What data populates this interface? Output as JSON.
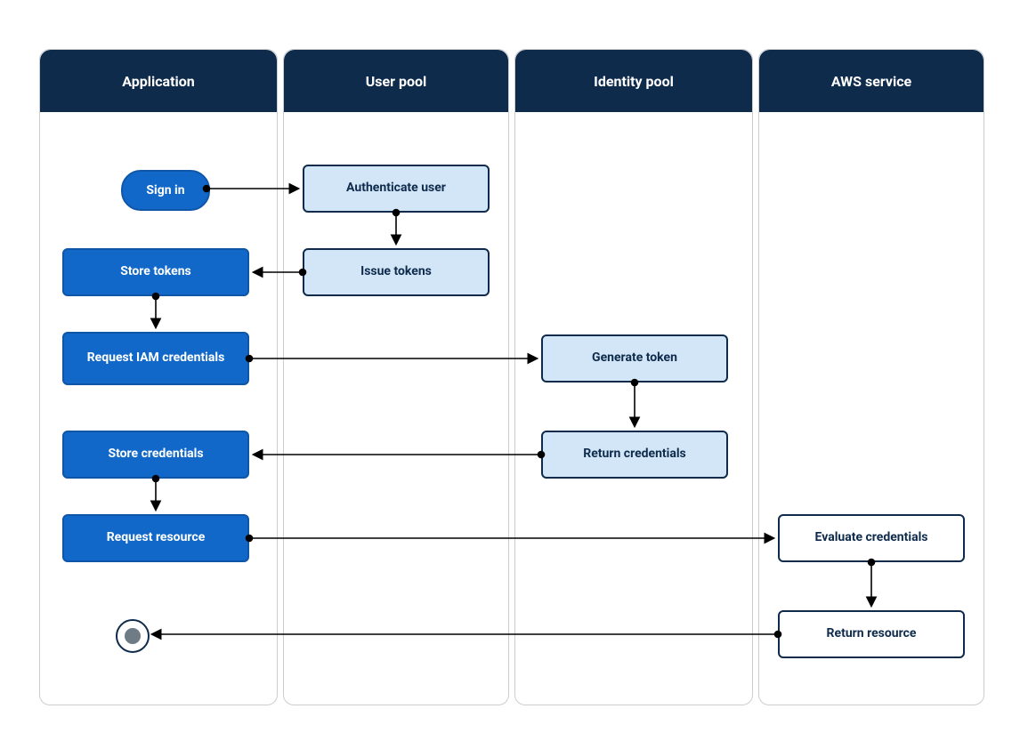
{
  "lanes": {
    "application": "Application",
    "user_pool": "User pool",
    "identity_pool": "Identity pool",
    "aws_service": "AWS service"
  },
  "nodes": {
    "sign_in": "Sign in",
    "authenticate_user": "Authenticate user",
    "issue_tokens": "Issue tokens",
    "store_tokens": "Store tokens",
    "request_iam": "Request IAM credentials",
    "generate_token": "Generate token",
    "return_credentials": "Return credentials",
    "store_credentials": "Store credentials",
    "request_resource": "Request resource",
    "evaluate_credentials": "Evaluate credentials",
    "return_resource": "Return resource"
  },
  "colors": {
    "lane_header": "#0f2b4c",
    "blue_fill": "#1168c9",
    "light_fill": "#d2e6f7",
    "border_dark": "#0f2b4c",
    "stroke": "#000000"
  },
  "chart_data": {
    "type": "table",
    "title": "AWS Cognito authentication flow sequence diagram",
    "lanes": [
      "Application",
      "User pool",
      "Identity pool",
      "AWS service"
    ],
    "steps": [
      {
        "from_lane": "Application",
        "from_node": "Sign in",
        "to_lane": "User pool",
        "to_node": "Authenticate user"
      },
      {
        "from_lane": "User pool",
        "from_node": "Authenticate user",
        "to_lane": "User pool",
        "to_node": "Issue tokens"
      },
      {
        "from_lane": "User pool",
        "from_node": "Issue tokens",
        "to_lane": "Application",
        "to_node": "Store tokens"
      },
      {
        "from_lane": "Application",
        "from_node": "Store tokens",
        "to_lane": "Application",
        "to_node": "Request IAM credentials"
      },
      {
        "from_lane": "Application",
        "from_node": "Request IAM credentials",
        "to_lane": "Identity pool",
        "to_node": "Generate token"
      },
      {
        "from_lane": "Identity pool",
        "from_node": "Generate token",
        "to_lane": "Identity pool",
        "to_node": "Return credentials"
      },
      {
        "from_lane": "Identity pool",
        "from_node": "Return credentials",
        "to_lane": "Application",
        "to_node": "Store credentials"
      },
      {
        "from_lane": "Application",
        "from_node": "Store credentials",
        "to_lane": "Application",
        "to_node": "Request resource"
      },
      {
        "from_lane": "Application",
        "from_node": "Request resource",
        "to_lane": "AWS service",
        "to_node": "Evaluate credentials"
      },
      {
        "from_lane": "AWS service",
        "from_node": "Evaluate credentials",
        "to_lane": "AWS service",
        "to_node": "Return resource"
      },
      {
        "from_lane": "AWS service",
        "from_node": "Return resource",
        "to_lane": "Application",
        "to_node": "END"
      }
    ]
  }
}
